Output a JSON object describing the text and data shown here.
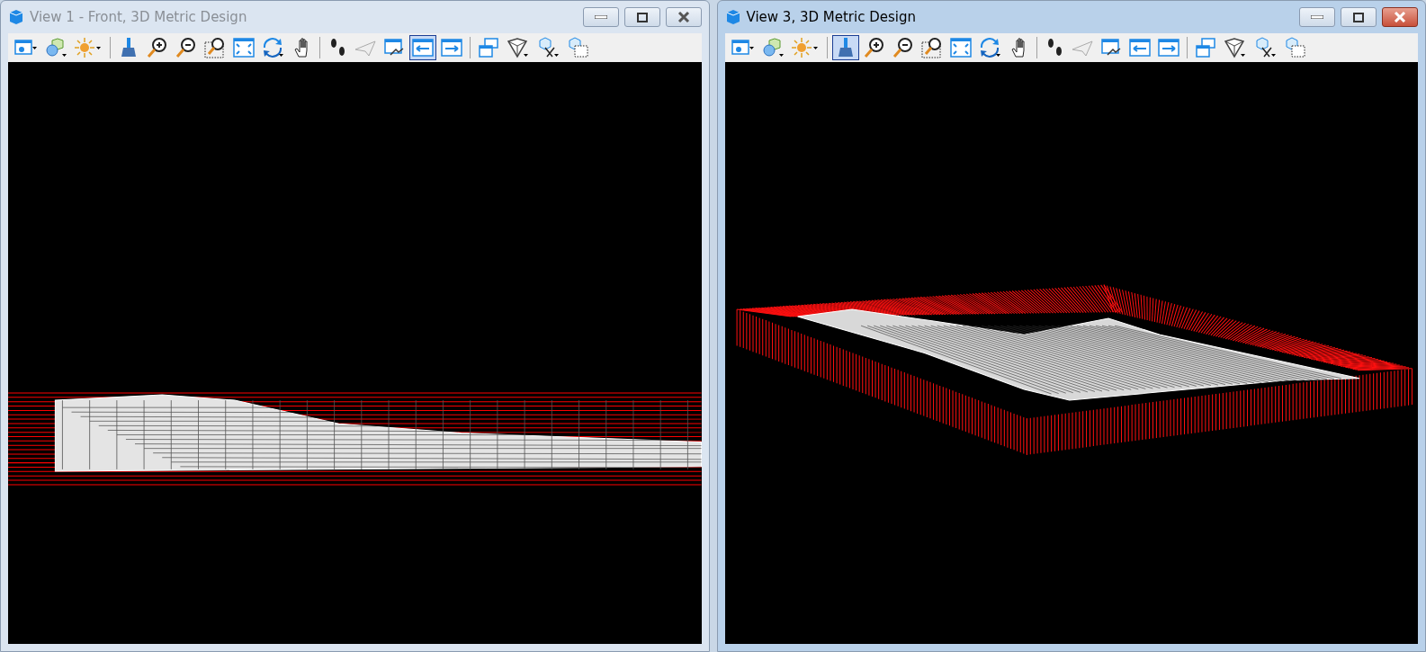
{
  "windows": [
    {
      "title": "View 1 - Front, 3D Metric Design",
      "active": false,
      "kind": "front",
      "tools": [
        {
          "kind": "view-attributes",
          "selected": false
        },
        {
          "kind": "display-style",
          "selected": false
        },
        {
          "kind": "lighting",
          "selected": false
        },
        {
          "kind": "separator"
        },
        {
          "kind": "update",
          "selected": false
        },
        {
          "kind": "zoom-in",
          "selected": false
        },
        {
          "kind": "zoom-out",
          "selected": false
        },
        {
          "kind": "window-area",
          "selected": false
        },
        {
          "kind": "fit-view",
          "selected": false
        },
        {
          "kind": "rotate",
          "selected": false
        },
        {
          "kind": "pan",
          "selected": false
        },
        {
          "kind": "separator"
        },
        {
          "kind": "walk",
          "selected": false
        },
        {
          "kind": "fly",
          "selected": false
        },
        {
          "kind": "view-dialog",
          "selected": false
        },
        {
          "kind": "previous",
          "selected": true
        },
        {
          "kind": "next",
          "selected": false
        },
        {
          "kind": "separator"
        },
        {
          "kind": "copy-view",
          "selected": false
        },
        {
          "kind": "clip-volume",
          "selected": false
        },
        {
          "kind": "clip-cut",
          "selected": false
        },
        {
          "kind": "clip-mask",
          "selected": false
        }
      ]
    },
    {
      "title": "View 3, 3D Metric Design",
      "active": true,
      "kind": "iso",
      "tools": [
        {
          "kind": "view-attributes",
          "selected": false
        },
        {
          "kind": "display-style",
          "selected": false
        },
        {
          "kind": "lighting",
          "selected": false
        },
        {
          "kind": "separator"
        },
        {
          "kind": "update",
          "selected": true
        },
        {
          "kind": "zoom-in",
          "selected": false
        },
        {
          "kind": "zoom-out",
          "selected": false
        },
        {
          "kind": "window-area",
          "selected": false
        },
        {
          "kind": "fit-view",
          "selected": false
        },
        {
          "kind": "rotate",
          "selected": false
        },
        {
          "kind": "pan",
          "selected": false
        },
        {
          "kind": "separator"
        },
        {
          "kind": "walk",
          "selected": false
        },
        {
          "kind": "fly",
          "selected": false
        },
        {
          "kind": "view-dialog",
          "selected": false
        },
        {
          "kind": "previous",
          "selected": false
        },
        {
          "kind": "next",
          "selected": false
        },
        {
          "kind": "separator"
        },
        {
          "kind": "copy-view",
          "selected": false
        },
        {
          "kind": "clip-volume",
          "selected": false
        },
        {
          "kind": "clip-cut",
          "selected": false
        },
        {
          "kind": "clip-mask",
          "selected": false
        }
      ]
    }
  ]
}
